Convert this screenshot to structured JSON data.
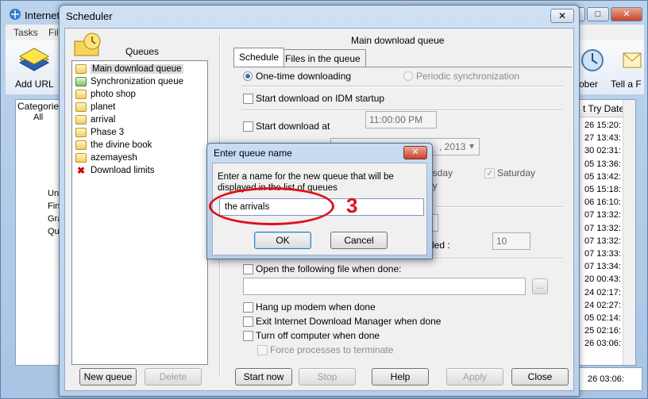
{
  "background_app": {
    "title": "Internet",
    "menu": [
      "Tasks",
      "File"
    ],
    "toolbar": {
      "add_url": "Add URL",
      "scheduler_partial": "ober",
      "tell_a_friend": "Tell a F"
    },
    "categories_label": "Categories",
    "tree_items": [
      "All",
      "Un",
      "Fin",
      "Gra",
      "Qu"
    ],
    "list_header": "t Try Date",
    "list_values": [
      "26 15:20:",
      "27 13:43:",
      "30 02:31:",
      "05 13:36:",
      "05 13:42:",
      "05 15:18:",
      "06 16:10:",
      "07 13:32:",
      "07 13:32:",
      "07 13:32:",
      "07 13:33:",
      "07 13:34:",
      "20 00:43:",
      "24 02:17:",
      "24 02:27:",
      "05 02:14:",
      "25 02:16:",
      "26 03:06:"
    ],
    "status_value": "26 03:06:"
  },
  "scheduler": {
    "title": "Scheduler",
    "close_glyph": "✕",
    "queues_label": "Queues",
    "queues": [
      {
        "label": "Main download queue",
        "icon": "folder-icon",
        "selected": true
      },
      {
        "label": "Synchronization queue",
        "icon": "sync-folder-icon"
      },
      {
        "label": "photo shop",
        "icon": "folder-icon"
      },
      {
        "label": "planet",
        "icon": "folder-icon"
      },
      {
        "label": "arrival",
        "icon": "folder-icon"
      },
      {
        "label": "Phase 3",
        "icon": "folder-icon"
      },
      {
        "label": "the divine book",
        "icon": "folder-icon"
      },
      {
        "label": "azemayesh",
        "icon": "folder-icon"
      },
      {
        "label": "Download limits",
        "icon": "red-x-icon"
      }
    ],
    "buttons": {
      "new_queue": "New queue",
      "delete": "Delete",
      "start_now": "Start now",
      "stop": "Stop",
      "help": "Help",
      "apply": "Apply",
      "close": "Close"
    },
    "queue_title": "Main download queue",
    "tabs": [
      "Schedule",
      "Files in the queue"
    ],
    "schedule": {
      "one_time": "One-time downloading",
      "periodic": "Periodic synchronization",
      "start_on_startup": "Start download on IDM startup",
      "start_at": "Start download at",
      "start_time": "11:00:00 PM",
      "date_partial": ", 2013",
      "day_partial_1": "esday",
      "day_partial_2": "ay",
      "saturday": "Saturday",
      "retry_partial": "led :",
      "retry_value": "10",
      "open_file": "Open the following file when done:",
      "open_file_path": "",
      "browse": "...",
      "hang_up": "Hang up modem when done",
      "exit_idm": "Exit Internet Download Manager when done",
      "turn_off": "Turn off computer when done",
      "force": "Force processes to terminate"
    }
  },
  "queue_name_dialog": {
    "title": "Enter queue name",
    "close_glyph": "✕",
    "prompt": "Enter a name for the new queue that will be displayed in the list of queues",
    "input_value": "the arrivals",
    "ok": "OK",
    "cancel": "Cancel"
  },
  "annotation": {
    "number": "3",
    "color": "#e0101a"
  }
}
